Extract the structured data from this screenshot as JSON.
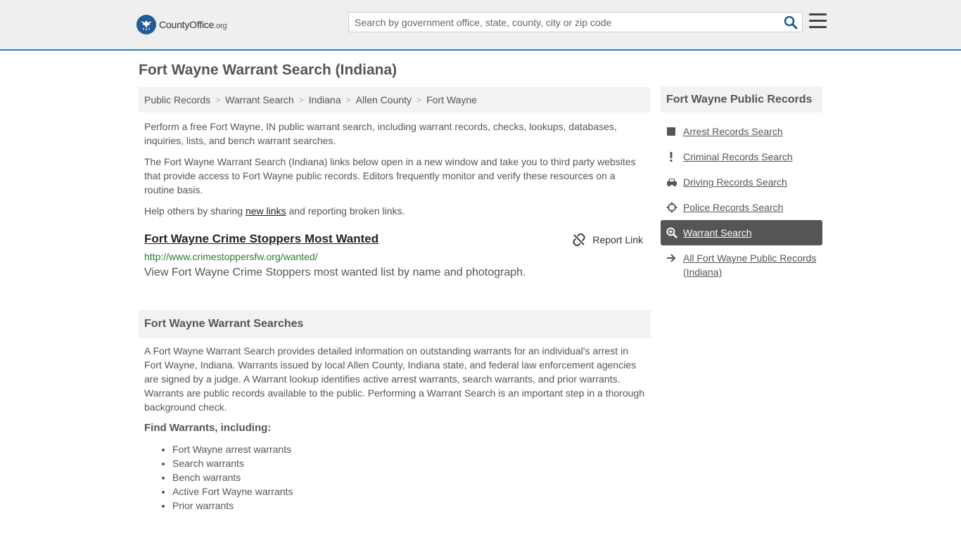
{
  "header": {
    "logo_text_main": "CountyOffice",
    "logo_text_tld": ".org",
    "search_placeholder": "Search by government office, state, county, city or zip code"
  },
  "page_title": "Fort Wayne Warrant Search (Indiana)",
  "breadcrumb": [
    "Public Records",
    "Warrant Search",
    "Indiana",
    "Allen County",
    "Fort Wayne"
  ],
  "intro": {
    "p1": "Perform a free Fort Wayne, IN public warrant search, including warrant records, checks, lookups, databases, inquiries, lists, and bench warrant searches.",
    "p2": "The Fort Wayne Warrant Search (Indiana) links below open in a new window and take you to third party websites that provide access to Fort Wayne public records. Editors frequently monitor and verify these resources on a routine basis.",
    "p3_before": "Help others by sharing ",
    "p3_link": "new links",
    "p3_after": " and reporting broken links."
  },
  "result": {
    "title": "Fort Wayne Crime Stoppers Most Wanted",
    "report_label": "Report Link",
    "url": "http://www.crimestoppersfw.org/wanted/",
    "description": "View Fort Wayne Crime Stoppers most wanted list by name and photograph."
  },
  "section": {
    "heading": "Fort Wayne Warrant Searches",
    "body": "A Fort Wayne Warrant Search provides detailed information on outstanding warrants for an individual's arrest in Fort Wayne, Indiana. Warrants issued by local Allen County, Indiana state, and federal law enforcement agencies are signed by a judge. A Warrant lookup identifies active arrest warrants, search warrants, and prior warrants. Warrants are public records available to the public. Performing a Warrant Search is an important step in a thorough background check.",
    "find_heading": "Find Warrants, including:",
    "find_items": [
      "Fort Wayne arrest warrants",
      "Search warrants",
      "Bench warrants",
      "Active Fort Wayne warrants",
      "Prior warrants"
    ]
  },
  "sidebar": {
    "heading": "Fort Wayne Public Records",
    "items": [
      {
        "label": "Arrest Records Search",
        "icon": "square-icon"
      },
      {
        "label": "Criminal Records Search",
        "icon": "exclamation-icon"
      },
      {
        "label": "Driving Records Search",
        "icon": "car-icon"
      },
      {
        "label": "Police Records Search",
        "icon": "crosshair-icon"
      },
      {
        "label": "Warrant Search",
        "icon": "search-plus-icon",
        "active": true
      },
      {
        "label": "All Fort Wayne Public Records (Indiana)",
        "icon": "arrow-right-icon"
      }
    ]
  },
  "colors": {
    "brand_blue": "#1f5d96",
    "header_border": "#2d7bbf",
    "url_green": "#2a7d2a",
    "active_bg": "#555555"
  }
}
